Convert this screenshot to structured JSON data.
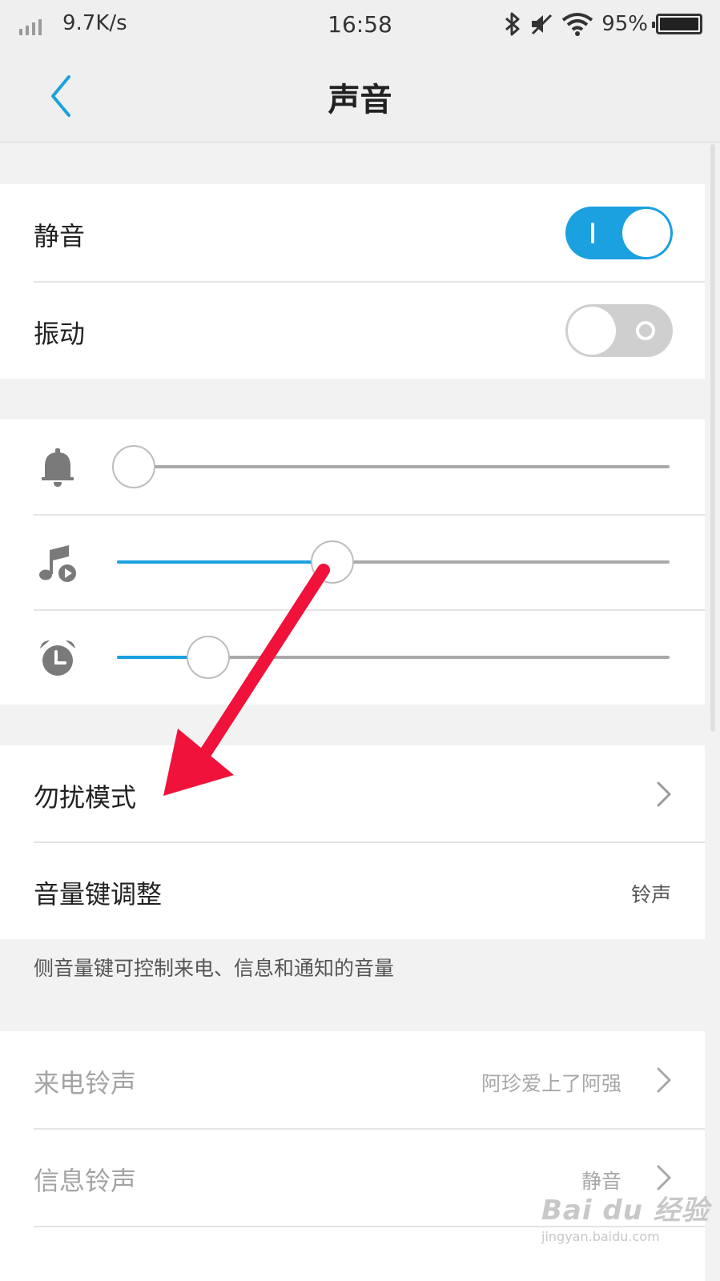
{
  "status_bar": {
    "net_speed": "9.7K/s",
    "time": "16:58",
    "battery_pct": "95%",
    "icons": [
      "signal-icon",
      "bluetooth-icon",
      "mute-icon",
      "wifi-icon",
      "battery-icon"
    ]
  },
  "header": {
    "title": "声音",
    "back_icon": "chevron-left-icon"
  },
  "toggles": [
    {
      "label": "静音",
      "state": "on"
    },
    {
      "label": "振动",
      "state": "off"
    }
  ],
  "volume": [
    {
      "icon": "bell-icon",
      "level": 0.03
    },
    {
      "icon": "music-note-icon",
      "level": 0.39
    },
    {
      "icon": "alarm-clock-icon",
      "level": 0.165
    }
  ],
  "settings": {
    "dnd_label": "勿扰模式",
    "volume_key_label": "音量键调整",
    "volume_key_value": "铃声",
    "note": "侧音量键可控制来电、信息和通知的音量"
  },
  "ringtones": {
    "call_label": "来电铃声",
    "call_value": "阿珍爱上了阿强",
    "message_label": "信息铃声",
    "message_value": "静音"
  },
  "watermark": {
    "logo": "Bai du 经验",
    "url": "jingyan.baidu.com"
  },
  "colors": {
    "accent": "#1ba0e0",
    "annotation_arrow": "#f0123a",
    "background": "#f2f2f2"
  }
}
